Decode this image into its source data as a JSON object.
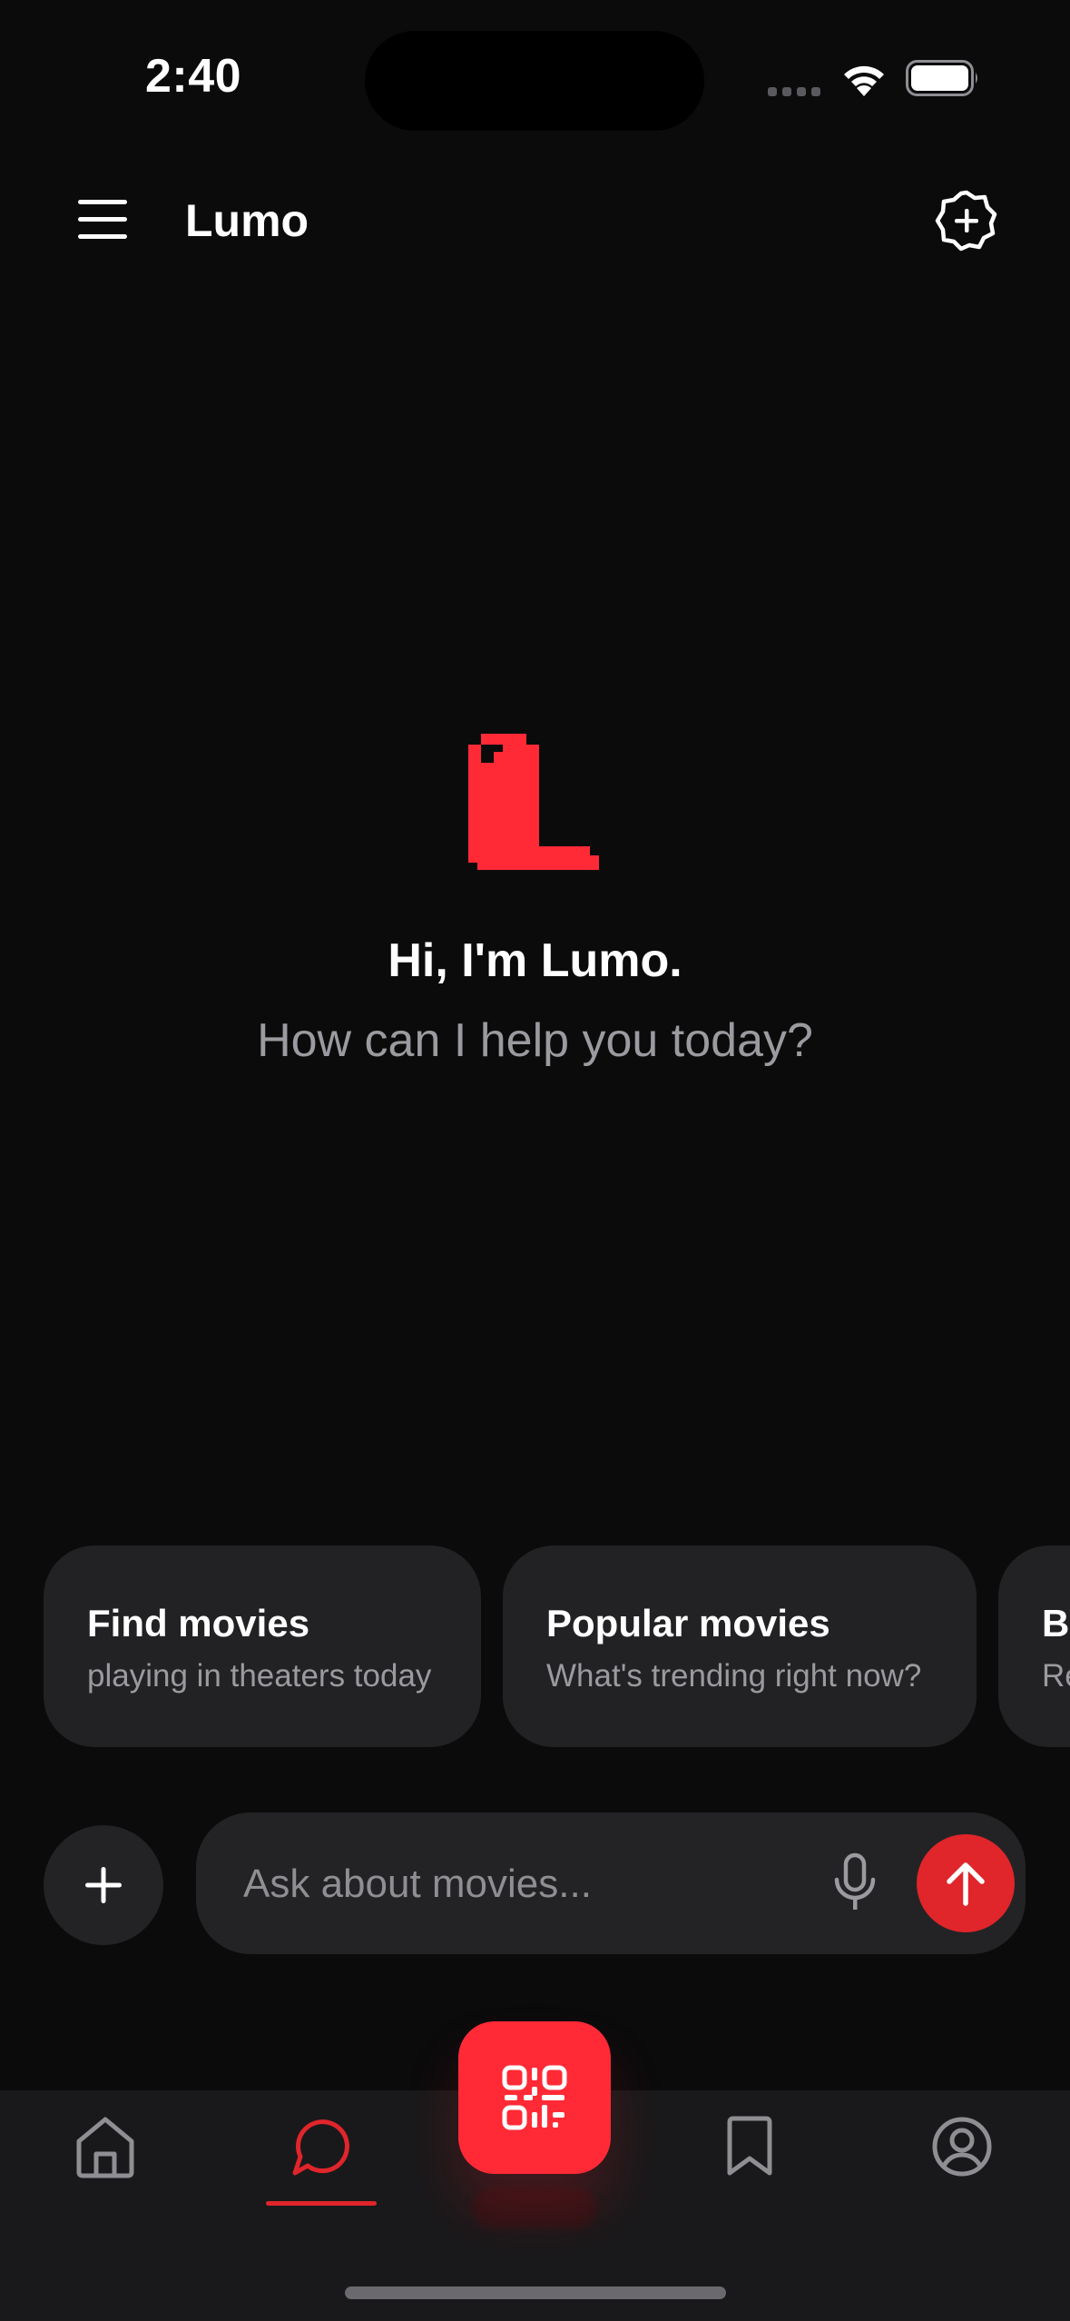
{
  "status_bar": {
    "time": "2:40"
  },
  "header": {
    "title": "Lumo"
  },
  "hero": {
    "greeting": "Hi, I'm Lumo.",
    "subtitle": "How can I help you today?"
  },
  "suggestions": [
    {
      "title": "Find movies",
      "subtitle": "playing in theaters today"
    },
    {
      "title": "Popular movies",
      "subtitle": "What's trending right now?"
    },
    {
      "title": "Bo",
      "subtitle": "Re"
    }
  ],
  "composer": {
    "placeholder": "Ask about movies..."
  },
  "tabs": [
    {
      "name": "home",
      "icon": "home-icon",
      "selected": false
    },
    {
      "name": "chat",
      "icon": "chat-bubble-icon",
      "selected": true
    },
    {
      "name": "scan",
      "icon": "qr-code-icon",
      "selected": false
    },
    {
      "name": "saved",
      "icon": "bookmark-icon",
      "selected": false
    },
    {
      "name": "profile",
      "icon": "profile-icon",
      "selected": false
    }
  ],
  "colors": {
    "background": "#0b0b0c",
    "accent": "#e0252b",
    "scan_button": "#ff2a36",
    "card": "#222224",
    "tabbar": "#19191b",
    "muted_text": "#9a9a9f"
  }
}
